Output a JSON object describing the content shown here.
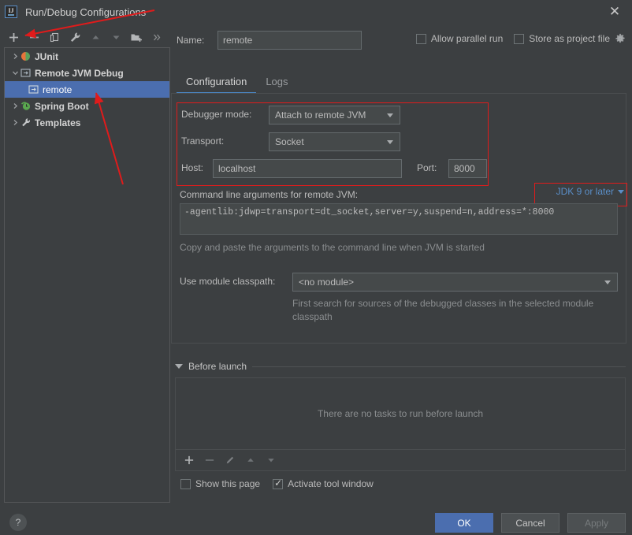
{
  "window": {
    "title": "Run/Debug Configurations",
    "logo_text": "IJ",
    "close_icon": "close-icon"
  },
  "toolbar": {
    "buttons": [
      {
        "name": "add-configuration-button",
        "icon": "plus-icon",
        "label": "+"
      },
      {
        "name": "remove-configuration-button",
        "icon": "minus-icon",
        "label": "−"
      },
      {
        "name": "copy-configuration-button",
        "icon": "copy-icon",
        "label": "Copy"
      },
      {
        "name": "edit-templates-button",
        "icon": "wrench-icon",
        "label": "Edit Templates"
      },
      {
        "name": "move-up-button",
        "icon": "arrow-up-icon",
        "label": "Move Up"
      },
      {
        "name": "move-down-button",
        "icon": "arrow-down-icon",
        "label": "Move Down"
      },
      {
        "name": "new-folder-button",
        "icon": "folder-add-icon",
        "label": "New Folder"
      },
      {
        "name": "more-options-button",
        "icon": "chevron-double-right-icon",
        "label": "»"
      }
    ]
  },
  "tree": {
    "items": [
      {
        "label": "JUnit",
        "icon": "junit-icon",
        "expanded": false,
        "selected": false,
        "child": false,
        "twisty": "›"
      },
      {
        "label": "Remote JVM Debug",
        "icon": "remote-jvm-icon",
        "expanded": true,
        "selected": false,
        "child": false,
        "twisty": "⌄"
      },
      {
        "label": "remote",
        "icon": "remote-jvm-icon",
        "expanded": false,
        "selected": true,
        "child": true,
        "twisty": ""
      },
      {
        "label": "Spring Boot",
        "icon": "spring-boot-icon",
        "expanded": false,
        "selected": false,
        "child": false,
        "twisty": "›"
      },
      {
        "label": "Templates",
        "icon": "wrench-icon",
        "expanded": false,
        "selected": false,
        "child": false,
        "twisty": "›"
      }
    ]
  },
  "help": {
    "label": "?"
  },
  "name_field": {
    "label": "Name:",
    "value": "remote",
    "placeholder": ""
  },
  "options": {
    "allow_parallel_run": {
      "label": "Allow parallel run",
      "checked": false
    },
    "store_as_project_file": {
      "label": "Store as project file",
      "checked": false
    },
    "gear_icon": "gear-icon"
  },
  "tabs": [
    {
      "label": "Configuration",
      "active": true
    },
    {
      "label": "Logs",
      "active": false
    }
  ],
  "configuration": {
    "debugger_mode": {
      "label": "Debugger mode:",
      "value": "Attach to remote JVM"
    },
    "transport": {
      "label": "Transport:",
      "value": "Socket"
    },
    "host": {
      "label": "Host:",
      "value": "localhost",
      "placeholder": ""
    },
    "port": {
      "label": "Port:",
      "value": "8000",
      "placeholder": ""
    },
    "command_line": {
      "label": "Command line arguments for remote JVM:",
      "value": "-agentlib:jdwp=transport=dt_socket,server=y,suspend=n,address=*:8000",
      "hint": "Copy and paste the arguments to the command line when JVM is started"
    },
    "jdk_selector": {
      "label": "JDK 9 or later",
      "icon": "chevron-down-icon"
    },
    "module_classpath": {
      "label": "Use module classpath:",
      "value": "<no module>",
      "hint": "First search for sources of the debugged classes in the selected module classpath"
    }
  },
  "before_launch": {
    "title": "Before launch",
    "empty_text": "There are no tasks to run before launch",
    "toolbar": [
      {
        "name": "add-task-button",
        "icon": "plus-icon",
        "label": "+"
      },
      {
        "name": "remove-task-button",
        "icon": "minus-icon",
        "label": "−"
      },
      {
        "name": "edit-task-button",
        "icon": "pencil-icon",
        "label": "Edit"
      },
      {
        "name": "move-task-up-button",
        "icon": "arrow-up-icon",
        "label": "Up"
      },
      {
        "name": "move-task-down-button",
        "icon": "arrow-down-icon",
        "label": "Down"
      }
    ],
    "show_this_page": {
      "label": "Show this page",
      "checked": false
    },
    "activate_tool_window": {
      "label": "Activate tool window",
      "checked": true
    }
  },
  "dialog_buttons": {
    "ok": "OK",
    "cancel": "Cancel",
    "apply": "Apply"
  },
  "colors": {
    "background": "#3c3f41",
    "selection": "#4b6eaf",
    "accent_link": "#5a8ec7",
    "annotation_red": "#e01b1b",
    "input_bg": "#45494a",
    "text": "#bbbbbb",
    "muted_text": "#8a8d8f"
  },
  "annotations": {
    "boxes": [
      {
        "name": "debugger-settings-highlight"
      },
      {
        "name": "jdk-selector-highlight"
      }
    ],
    "arrows": [
      {
        "name": "arrow-to-add-button"
      },
      {
        "name": "arrow-to-remote-config"
      }
    ]
  }
}
